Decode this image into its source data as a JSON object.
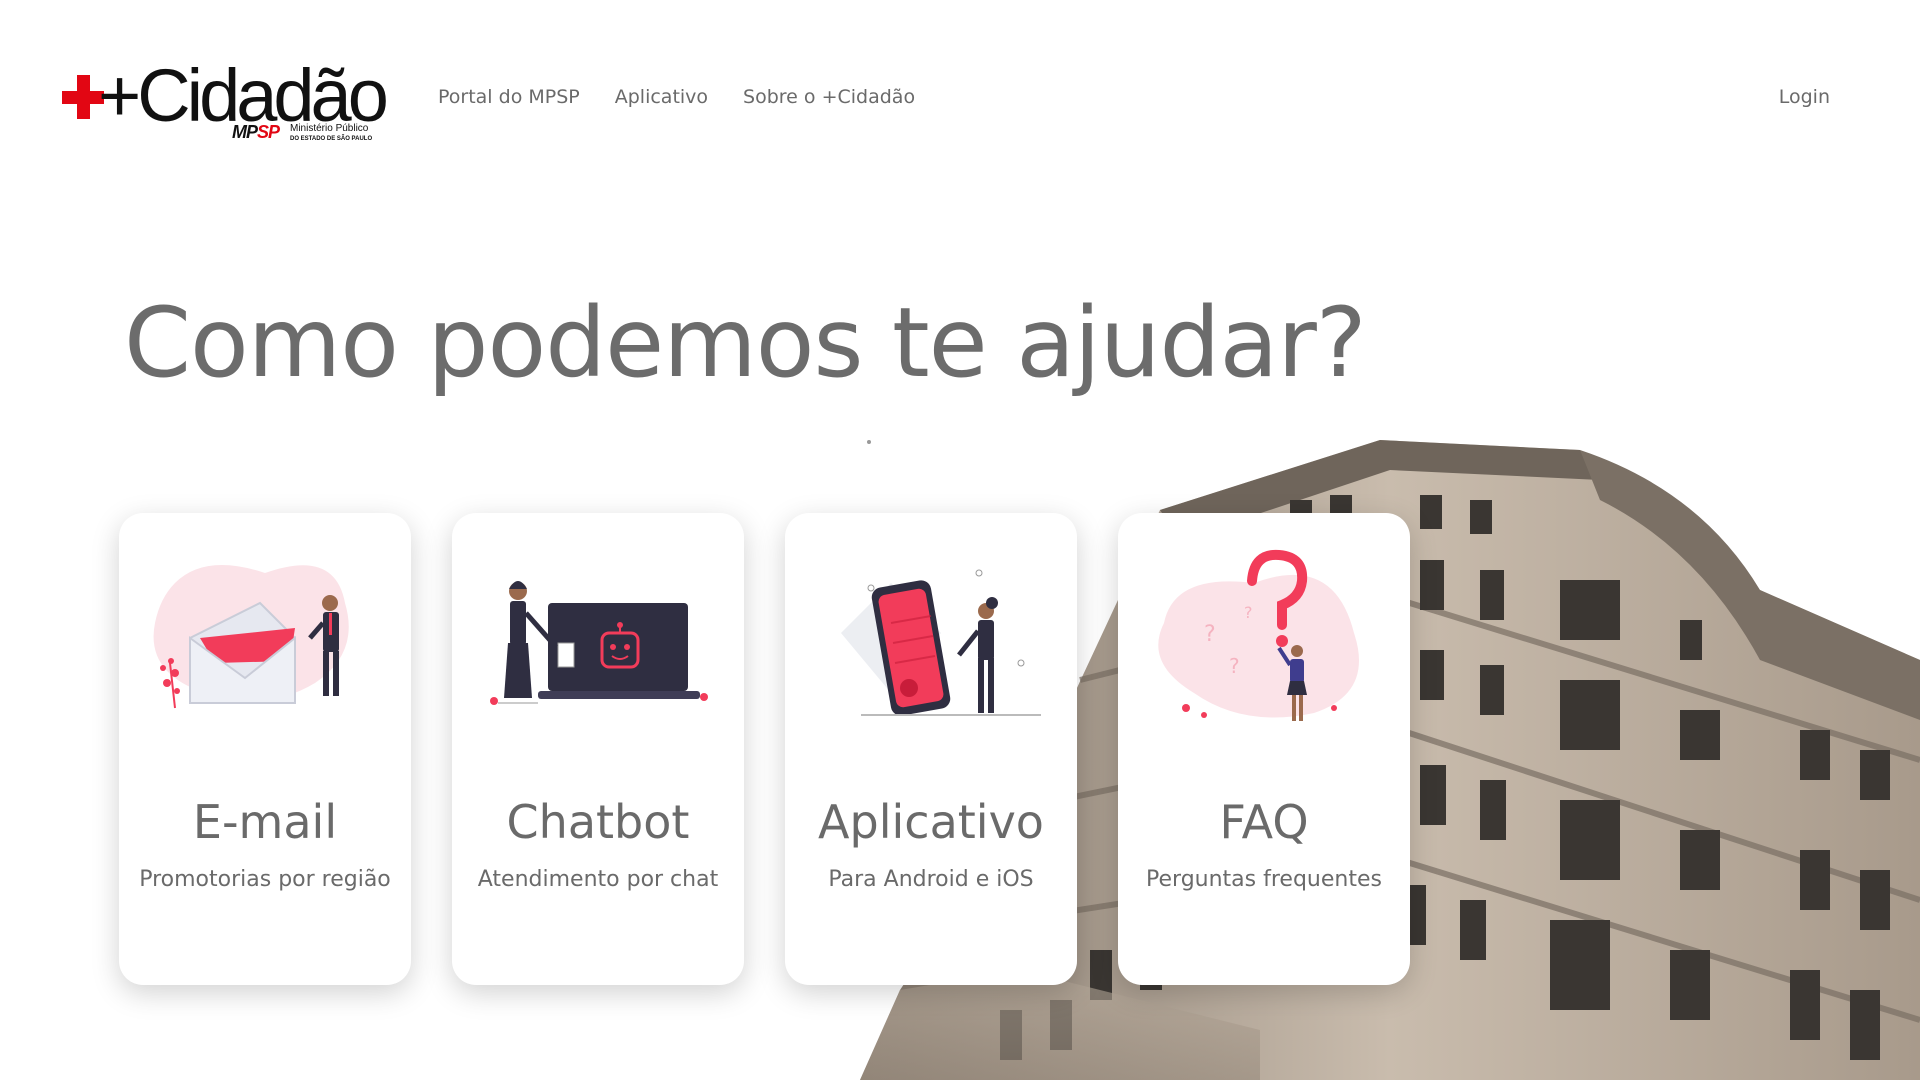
{
  "header": {
    "logo": {
      "wordmark": "+Cidadão",
      "brand_prefix": "MP",
      "brand_suffix": "SP",
      "org_line1": "Ministério Público",
      "org_line2": "DO ESTADO DE SÃO PAULO"
    },
    "nav": [
      {
        "label": "Portal do MPSP"
      },
      {
        "label": "Aplicativo"
      },
      {
        "label": "Sobre o +Cidadão"
      }
    ],
    "login_label": "Login"
  },
  "hero": {
    "title": "Como podemos te ajudar?"
  },
  "cards": [
    {
      "title": "E-mail",
      "subtitle": "Promotorias por região",
      "icon": "email-illustration"
    },
    {
      "title": "Chatbot",
      "subtitle": "Atendimento por chat",
      "icon": "chatbot-illustration"
    },
    {
      "title": "Aplicativo",
      "subtitle": "Para Android e iOS",
      "icon": "mobile-app-illustration"
    },
    {
      "title": "FAQ",
      "subtitle": "Perguntas frequentes",
      "icon": "faq-illustration"
    }
  ],
  "colors": {
    "accent": "#e20613",
    "illustration_red": "#f23c5a",
    "illustration_dark": "#2f2e41",
    "text": "#6a6a6a"
  }
}
